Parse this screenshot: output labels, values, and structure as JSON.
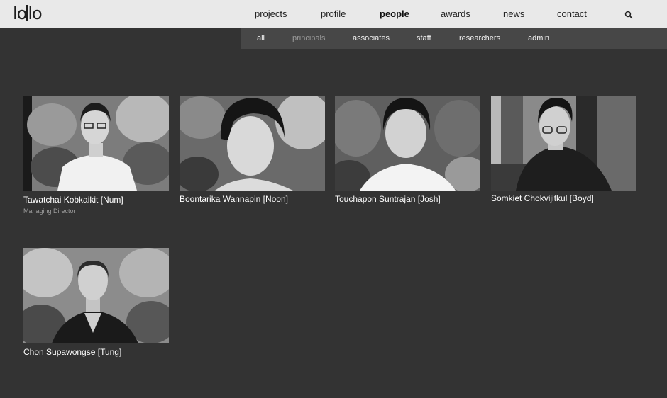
{
  "logo": {
    "text_left": "lo",
    "text_right": "lo"
  },
  "nav": {
    "items": [
      {
        "label": "projects"
      },
      {
        "label": "profile"
      },
      {
        "label": "people",
        "active": true
      },
      {
        "label": "awards"
      },
      {
        "label": "news"
      },
      {
        "label": "contact"
      }
    ],
    "search_icon": "search-icon"
  },
  "subnav": {
    "items": [
      {
        "label": "all"
      },
      {
        "label": "principals",
        "active": true
      },
      {
        "label": "associates"
      },
      {
        "label": "staff"
      },
      {
        "label": "researchers"
      },
      {
        "label": "admin"
      }
    ]
  },
  "people": [
    {
      "name": "Tawatchai Kobkaikit [Num]",
      "role": "Managing Director"
    },
    {
      "name": "Boontarika Wannapin [Noon]"
    },
    {
      "name": "Touchapon Suntrajan [Josh]"
    },
    {
      "name": "Somkiet Chokvijitkul [Boyd]"
    },
    {
      "name": "Chon Supawongse [Tung]"
    }
  ],
  "colors": {
    "background": "#333333",
    "header": "#e9e9e9",
    "subnav": "#474747",
    "subnav_active": "#9a9a9a",
    "role_text": "#9c9c9c"
  }
}
